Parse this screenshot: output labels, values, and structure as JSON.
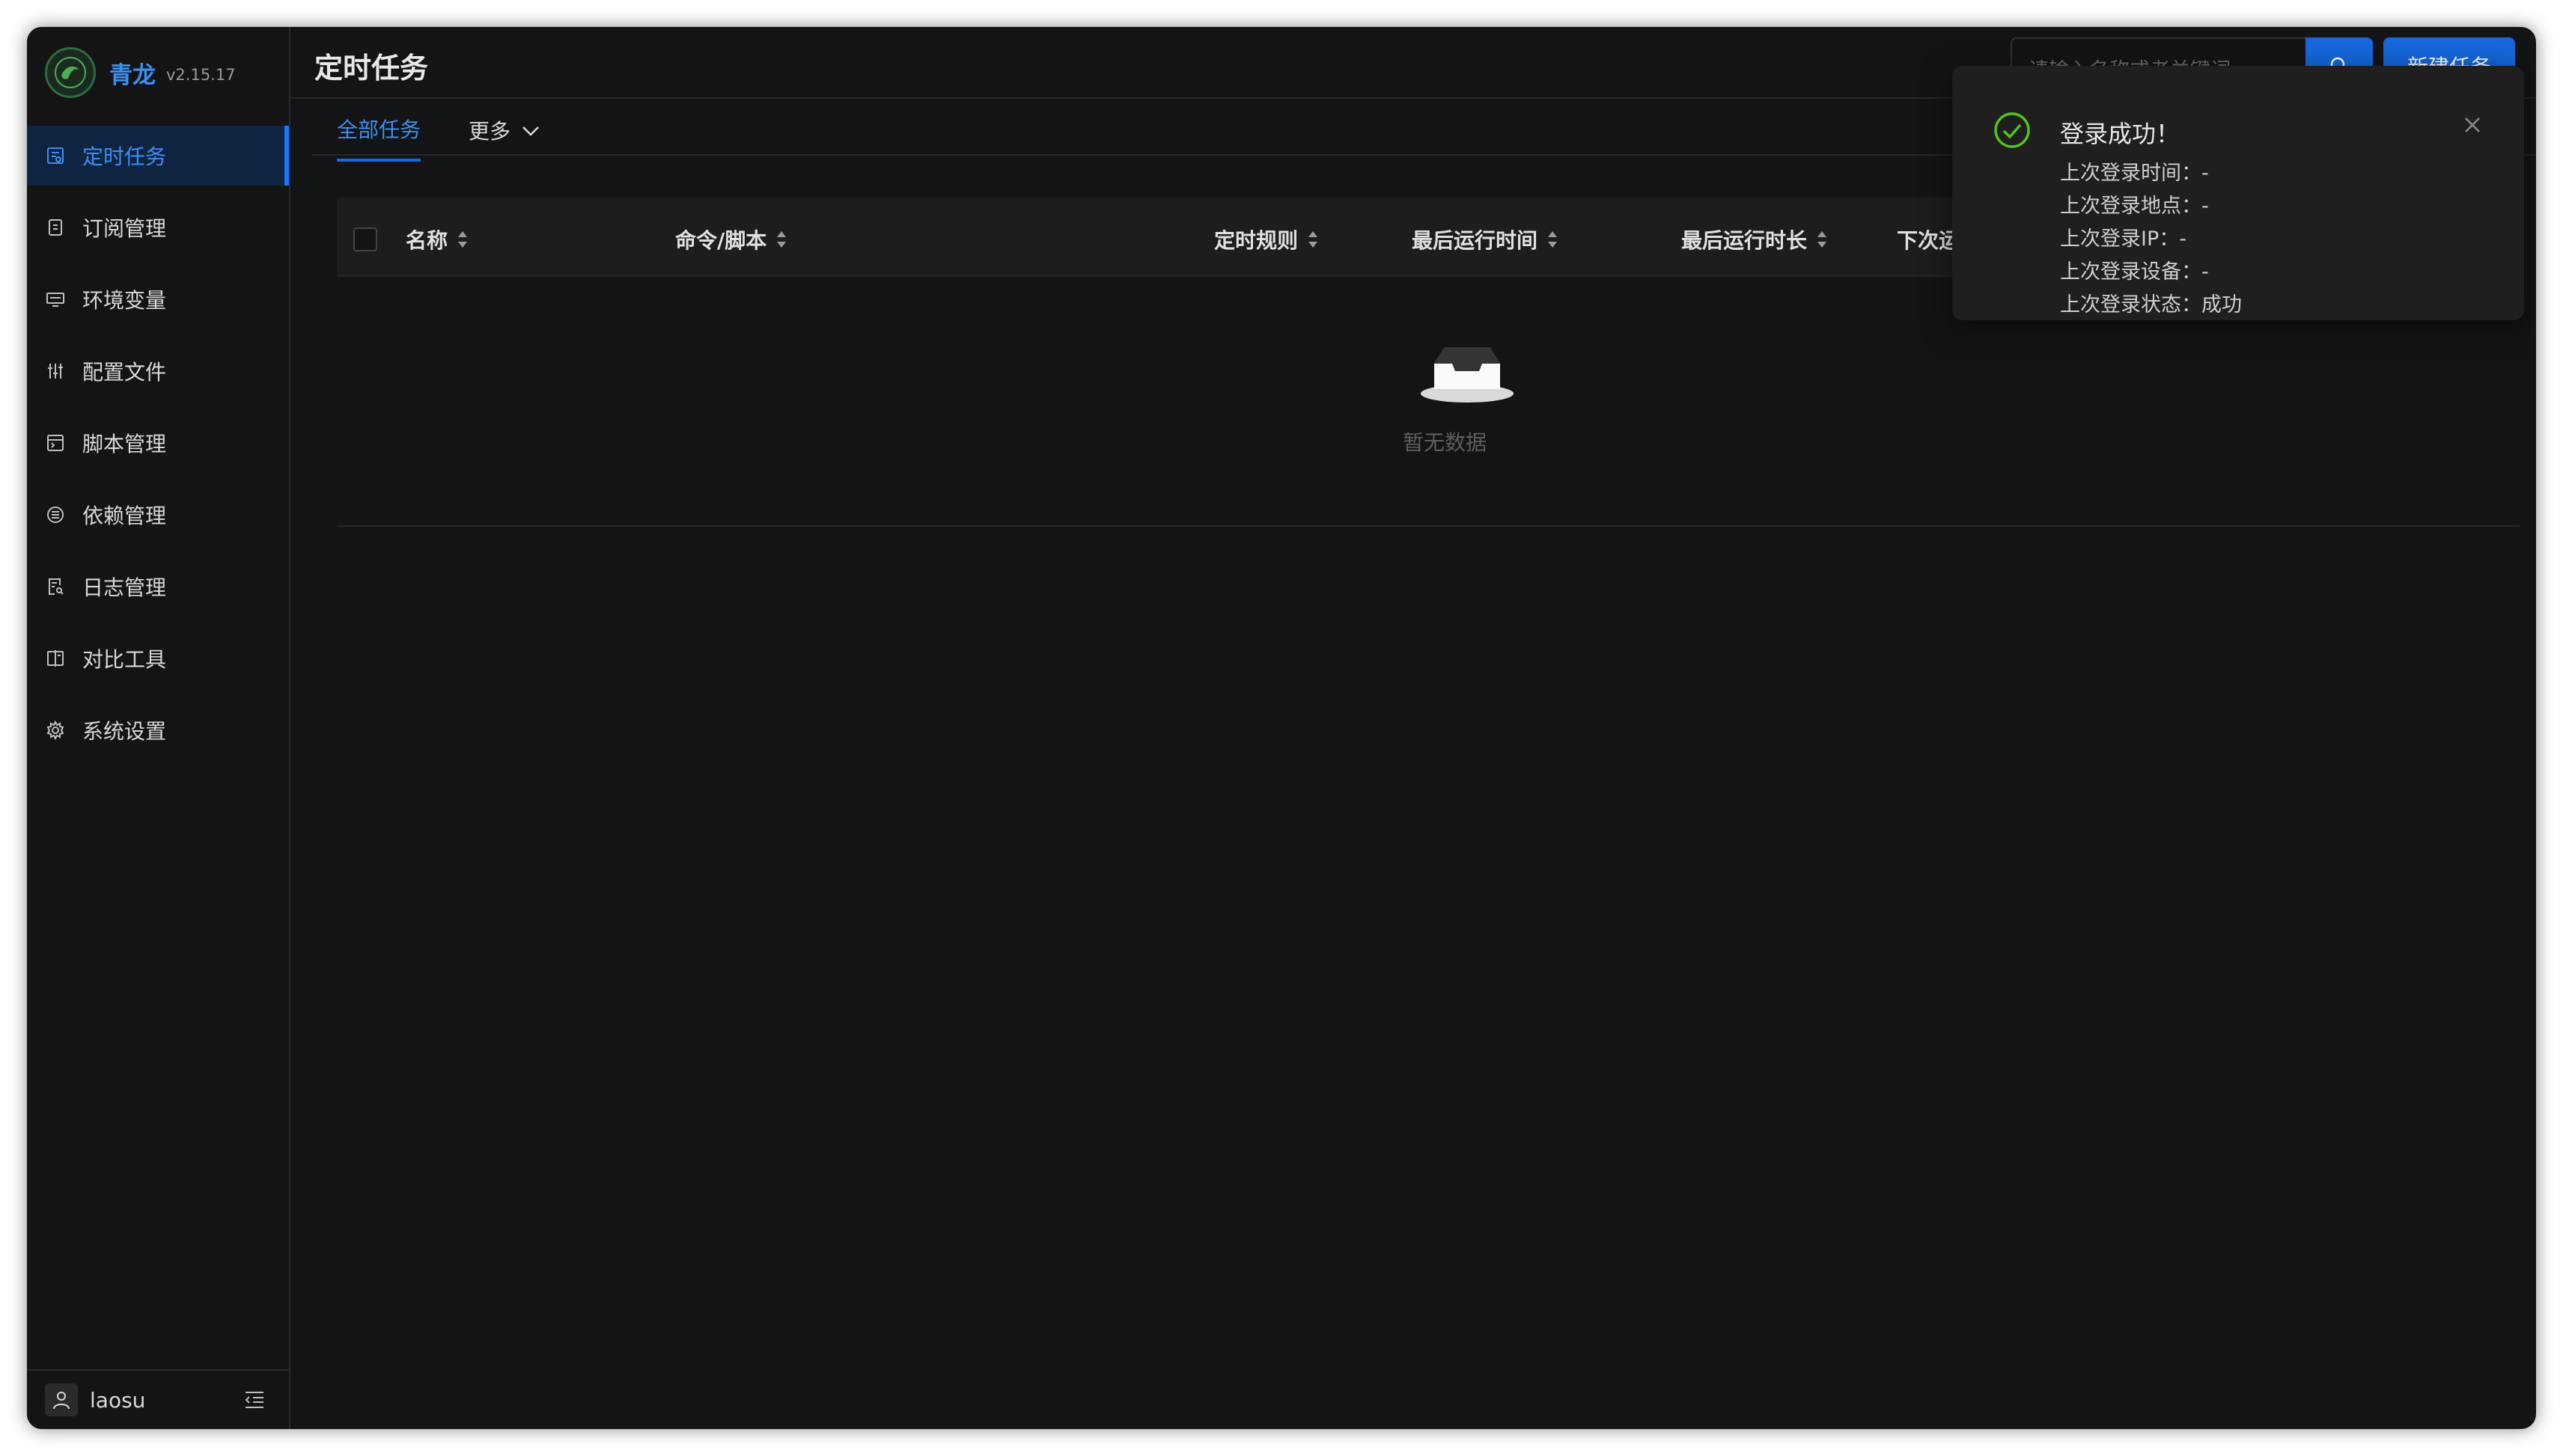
{
  "app": {
    "name": "青龙",
    "version": "v2.15.17"
  },
  "sidebar": {
    "items": [
      {
        "label": "定时任务",
        "icon": "calendar-icon",
        "active": true
      },
      {
        "label": "订阅管理",
        "icon": "subscription-icon",
        "active": false
      },
      {
        "label": "环境变量",
        "icon": "desktop-icon",
        "active": false
      },
      {
        "label": "配置文件",
        "icon": "control-icon",
        "active": false
      },
      {
        "label": "脚本管理",
        "icon": "code-icon",
        "active": false
      },
      {
        "label": "依赖管理",
        "icon": "list-icon",
        "active": false
      },
      {
        "label": "日志管理",
        "icon": "file-search-icon",
        "active": false
      },
      {
        "label": "对比工具",
        "icon": "diff-icon",
        "active": false
      },
      {
        "label": "系统设置",
        "icon": "gear-icon",
        "active": false
      }
    ],
    "user": {
      "name": "laosu"
    }
  },
  "header": {
    "title": "定时任务",
    "search_placeholder": "请输入名称或者关键词",
    "new_task_label": "新建任务"
  },
  "tabs": [
    {
      "label": "全部任务",
      "active": true
    },
    {
      "label": "更多",
      "active": false
    }
  ],
  "table": {
    "columns": [
      "名称",
      "命令/脚本",
      "定时规则",
      "最后运行时间",
      "最后运行时长",
      "下次运"
    ],
    "empty_text": "暂无数据"
  },
  "notification": {
    "title": "登录成功！",
    "lines": [
      "上次登录时间：-",
      "上次登录地点：-",
      "上次登录IP：-",
      "上次登录设备：-",
      "上次登录状态：成功"
    ]
  },
  "colors": {
    "accent": "#1668dc",
    "link": "#3d8ff2",
    "success": "#52c41a",
    "background": "#131416",
    "sidebar_active_bg": "#0e2440"
  }
}
